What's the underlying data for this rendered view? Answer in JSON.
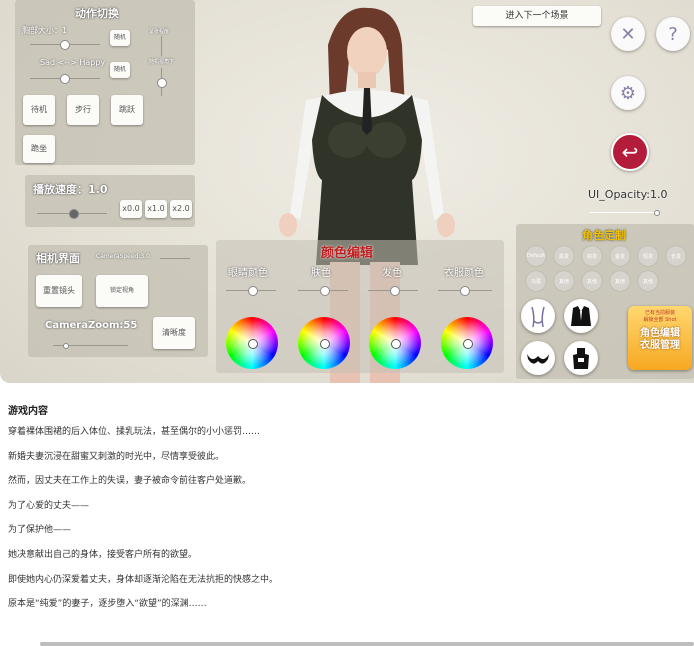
{
  "game": {
    "action_panel": {
      "title": "动作切换",
      "breast_size_label": "胸部大小：1",
      "mood_label": "Sad <--> Happy",
      "small_btn_1": "随机",
      "small_btn_2": "随机",
      "right_label_1": "紧张程度",
      "right_label_2": "随机视角下",
      "action_buttons": [
        "待机",
        "步行",
        "跳跃",
        "跪坐"
      ]
    },
    "speed_panel": {
      "title": "播放速度：1.0",
      "speed_buttons": [
        "x0.0",
        "x1.0",
        "x2.0"
      ]
    },
    "camera_panel": {
      "title": "相机界面",
      "speed_label": "CameraSpeed:3.0",
      "btn_reset": "重置镜头",
      "btn_lock": "锁定视角",
      "zoom_label": "CameraZoom:55",
      "btn_clear": "清晰度"
    },
    "color_panel": {
      "title": "颜色编辑",
      "columns": [
        "眼睛颜色",
        "肤色",
        "发色",
        "衣服颜色"
      ]
    },
    "top_button": "进入下一个场景",
    "ui_opacity": "UI_Opacity:1.0",
    "role_panel": {
      "title": "角色定制",
      "chips": [
        "Default",
        "黑发",
        "棕发",
        "金发",
        "短发",
        "长发",
        "马尾",
        "其他",
        "其他",
        "其他",
        "其他"
      ],
      "promo_line1": "已有当前服装",
      "promo_line2": "解锁全部 Shot",
      "promo_main": "角色编辑\n衣服管理"
    }
  },
  "article": {
    "heading": "游戏内容",
    "paragraphs": [
      "穿着裸体围裙的后入体位、揉乳玩法，甚至偶尔的小小惩罚……",
      "新婚夫妻沉浸在甜蜜又刺激的时光中，尽情享受彼此。",
      "然而，因丈夫在工作上的失误，妻子被命令前往客户处道歉。",
      "为了心爱的丈夫——",
      "为了保护他——",
      "她决意献出自己的身体，接受客户所有的欲望。",
      "即使她内心仍深爱着丈夫，身体却逐渐沦陷在无法抗拒的快感之中。",
      "原本是“纯爱”的妻子，逐步堕入“欲望”的深渊……"
    ]
  }
}
